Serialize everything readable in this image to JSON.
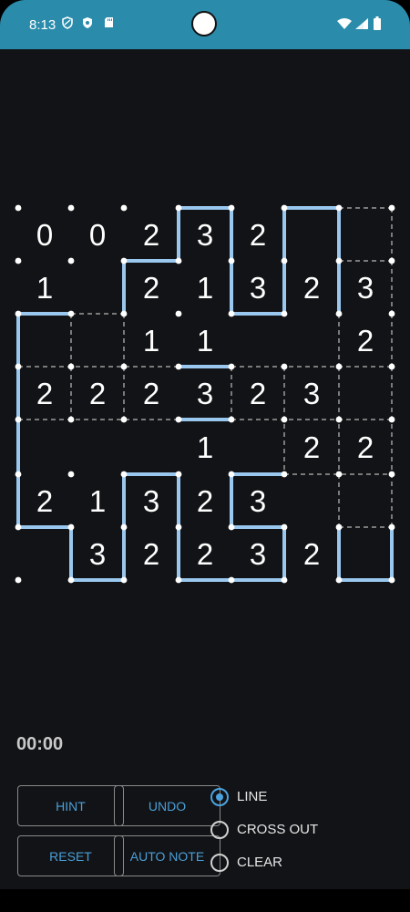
{
  "status_bar": {
    "time": "8:13"
  },
  "puzzle": {
    "clues": [
      [
        "0",
        "0",
        "2",
        "3",
        "2",
        "",
        ""
      ],
      [
        "1",
        "",
        "2",
        "1",
        "3",
        "2",
        "3"
      ],
      [
        "",
        "",
        "1",
        "1",
        "",
        "",
        "2"
      ],
      [
        "2",
        "2",
        "2",
        "3",
        "2",
        "3",
        ""
      ],
      [
        "",
        "",
        "",
        "1",
        "",
        "2",
        "2"
      ],
      [
        "2",
        "1",
        "3",
        "2",
        "3",
        "",
        ""
      ],
      [
        "",
        "3",
        "2",
        "2",
        "3",
        "2",
        ""
      ]
    ],
    "colors": {
      "line": "#99c7ee",
      "dot": "#ffffff",
      "crossed": "#7a7a7a",
      "background": "#121316",
      "accent": "#4aa3df"
    }
  },
  "timer": "00:00",
  "buttons": {
    "hint": "HINT",
    "undo": "UNDO",
    "reset": "RESET",
    "auto_note": "AUTO NOTE"
  },
  "modes": [
    {
      "label": "LINE",
      "selected": true
    },
    {
      "label": "CROSS OUT",
      "selected": false
    },
    {
      "label": "CLEAR",
      "selected": false
    }
  ]
}
